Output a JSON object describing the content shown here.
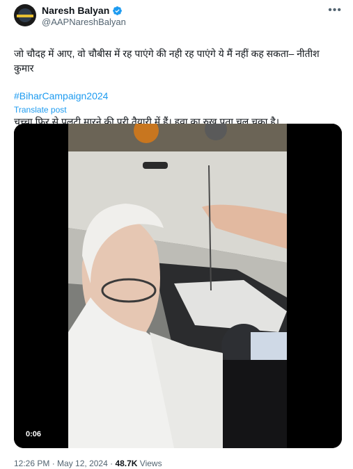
{
  "author": {
    "name": "Naresh Balyan",
    "handle": "@AAPNareshBalyan",
    "verified": true,
    "avatar_icon": "profile-avatar"
  },
  "post": {
    "text_line1": "जो चौदह में आए, वो चौबीस में रह पाएंगे की नही रह पाएंगे ये मैं नहीं कह सकता– नीतीश कुमार",
    "text_line2": "चच्चा फिर से पलटी मारने की पूरी तैयारी में हैं। हवा का रुख पता चल चुका है।",
    "hashtag": "#BiharCampaign2024",
    "translate_label": "Translate post",
    "more_icon": "more-dots-icon"
  },
  "video": {
    "duration": "0:06"
  },
  "footer": {
    "time": "12:26 PM",
    "separator": " · ",
    "date": "May 12, 2024",
    "views_count": "48.7K",
    "views_label": " Views"
  },
  "colors": {
    "link": "#1d9bf0",
    "muted": "#536471",
    "text": "#0f1419"
  }
}
